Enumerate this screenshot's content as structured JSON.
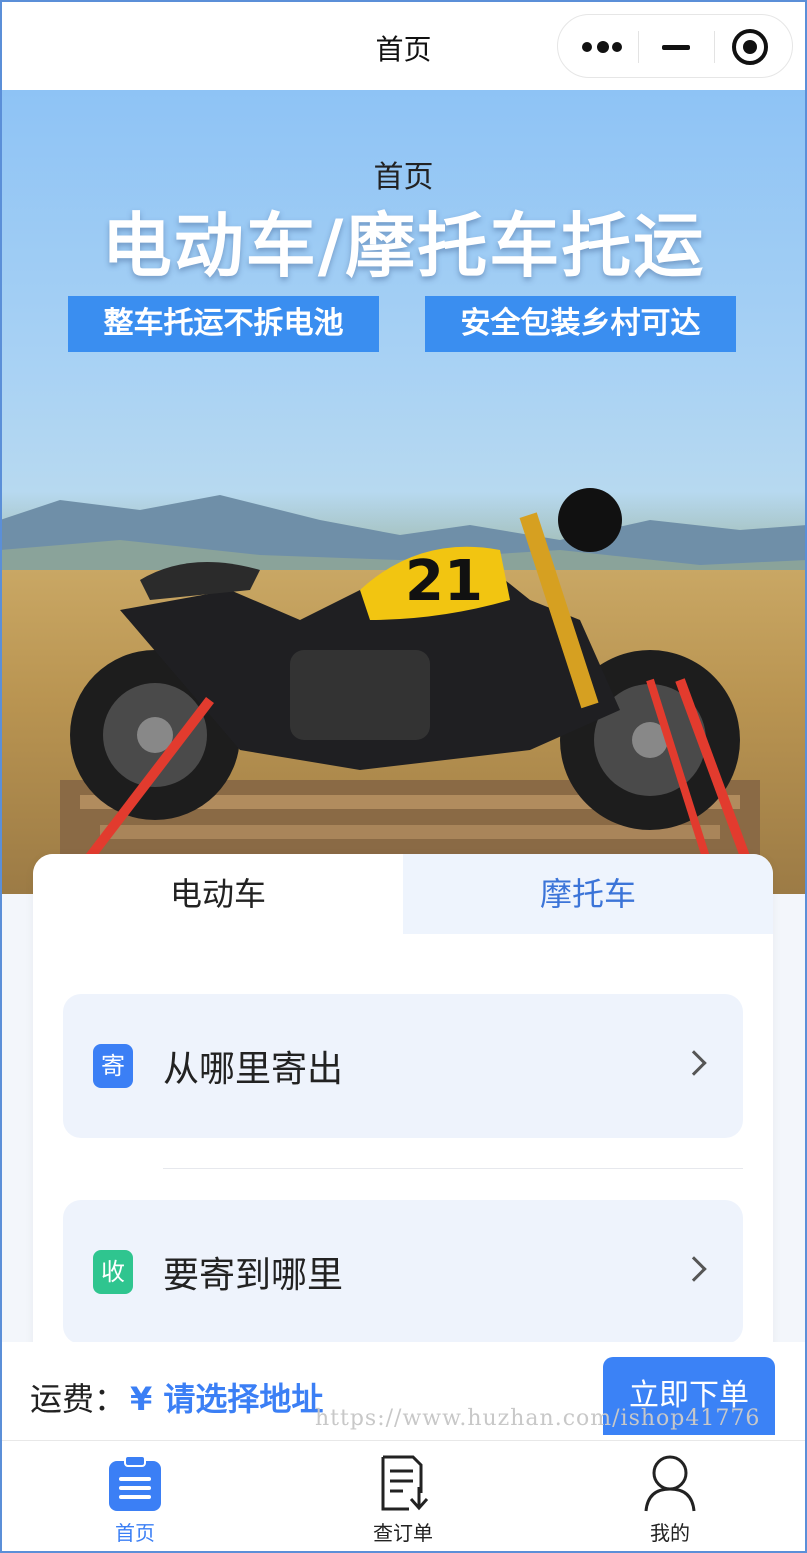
{
  "navbar": {
    "title": "首页"
  },
  "banner": {
    "page_title": "首页",
    "headline": "电动车/摩托车托运",
    "tags": [
      "整车托运不拆电池",
      "安全包装乡村可达"
    ]
  },
  "tabs": [
    {
      "label": "电动车",
      "active": true
    },
    {
      "label": "摩托车",
      "active": false
    }
  ],
  "address": {
    "from": {
      "badge": "寄",
      "label": "从哪里寄出"
    },
    "to": {
      "badge": "收",
      "label": "要寄到哪里"
    }
  },
  "fee": {
    "label": "运费：",
    "value": "¥ 请选择地址"
  },
  "order_button": "立即下单",
  "watermark": "https://www.huzhan.com/ishop41776",
  "tabbar": {
    "items": [
      {
        "label": "首页",
        "icon": "clipboard-icon",
        "active": true
      },
      {
        "label": "查订单",
        "icon": "order-download-icon",
        "active": false
      },
      {
        "label": "我的",
        "icon": "user-icon",
        "active": false
      }
    ]
  },
  "colors": {
    "accent": "#3b7ff5",
    "send_badge": "#3b7ff5",
    "receive_badge": "#2fc58f",
    "tag_blue": "#3a8ef0"
  }
}
